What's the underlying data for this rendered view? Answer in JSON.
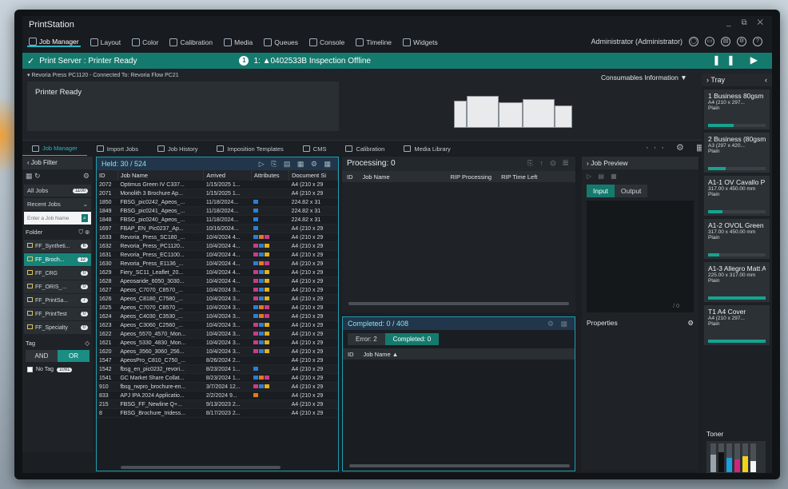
{
  "app": {
    "title": "PrintStation",
    "window_controls": "_ ⧉ ✕"
  },
  "menu": [
    {
      "label": "Job Manager",
      "active": true
    },
    {
      "label": "Layout"
    },
    {
      "label": "Color"
    },
    {
      "label": "Calibration"
    },
    {
      "label": "Media"
    },
    {
      "label": "Queues"
    },
    {
      "label": "Console"
    },
    {
      "label": "Timeline"
    },
    {
      "label": "Widgets"
    }
  ],
  "user": "Administrator (Administrator)",
  "status": {
    "server": "Print Server : Printer Ready",
    "count": "1",
    "alert": "1: ▲0402533B  Inspection Offline",
    "controls": "❚❚ ▶"
  },
  "printer": {
    "connection": "Revoria Press PC1120 - Connected To: Revoria Flow PC21",
    "state": "Printer Ready",
    "consumables": "Consumables Information ▼"
  },
  "tabs": [
    {
      "label": "Job Manager",
      "active": true
    },
    {
      "label": "Import Jobs"
    },
    {
      "label": "Job History"
    },
    {
      "label": "Imposition Templates"
    },
    {
      "label": "CMS"
    },
    {
      "label": "Calibration"
    },
    {
      "label": "Media Library"
    }
  ],
  "tabs_right": "··· ⚙ ▦",
  "left": {
    "filter_label": "Job Filter",
    "all_jobs": "All Jobs",
    "all_count": "1100",
    "recent": "Recent Jobs",
    "search_placeholder": "Enter a Job Name",
    "folder_label": "Folder",
    "folders": [
      {
        "name": "FF_Syntheti...",
        "count": "6"
      },
      {
        "name": "FF_Broch...",
        "count": "12",
        "sel": true
      },
      {
        "name": "FF_CRG",
        "count": "0"
      },
      {
        "name": "FF_ORIS_...",
        "count": "0"
      },
      {
        "name": "FF_PrintSa...",
        "count": "7"
      },
      {
        "name": "FF_PrintTest",
        "count": "0"
      },
      {
        "name": "FF_Specialty",
        "count": "0"
      }
    ],
    "tag_label": "Tag",
    "and": "AND",
    "or": "OR",
    "notag": "No Tag",
    "notag_count": "1091"
  },
  "held": {
    "title": "Held: 30 / 524",
    "tools": "▷ ⎘ ▤ ▦ ⚙ ▦",
    "columns": [
      "ID",
      "Job Name",
      "Arrived",
      "Attributes",
      "Document Si"
    ],
    "rows": [
      [
        "2072",
        "Optimus Green IV C337...",
        "1/15/2025 1...",
        "",
        "A4 (210 x 29"
      ],
      [
        "2071",
        "Monolith 3 Brochure Ap...",
        "1/15/2025 1...",
        "",
        "A4 (210 x 29"
      ],
      [
        "1850",
        "FBSG_pic0242_Apeos_...",
        "11/18/2024...",
        "b",
        "224.82 x 31"
      ],
      [
        "1849",
        "FBSG_pic0241_Apeos_...",
        "11/18/2024...",
        "b",
        "224.82 x 31"
      ],
      [
        "1848",
        "FBSG_pic0240_Apeos_...",
        "11/18/2024...",
        "b",
        "224.82 x 31"
      ],
      [
        "1697",
        "FBAP_EN_Pic0237_Ap...",
        "10/16/2024...",
        "b",
        "A4 (210 x 29"
      ],
      [
        "1633",
        "Revoria_Press_SC180_...",
        "10/4/2024 4...",
        "m",
        "A4 (210 x 29"
      ],
      [
        "1632",
        "Revoria_Press_PC1120...",
        "10/4/2024 4...",
        "d",
        "A4 (210 x 29"
      ],
      [
        "1631",
        "Revoria_Press_EC1100...",
        "10/4/2024 4...",
        "d",
        "A4 (210 x 29"
      ],
      [
        "1630",
        "Revoria_Press_E1136_...",
        "10/4/2024 4...",
        "m",
        "A4 (210 x 29"
      ],
      [
        "1629",
        "Fiery_SC11_Leaflet_20...",
        "10/4/2024 4...",
        "d",
        "A4 (210 x 29"
      ],
      [
        "1628",
        "Apeosaride_6050_3030...",
        "10/4/2024 4...",
        "d",
        "A4 (210 x 29"
      ],
      [
        "1627",
        "Apeos_C7070_C8570_...",
        "10/4/2024 3...",
        "d",
        "A4 (210 x 29"
      ],
      [
        "1626",
        "Apeos_C8180_C7580_...",
        "10/4/2024 3...",
        "d",
        "A4 (210 x 29"
      ],
      [
        "1625",
        "Apeos_C7070_C8570_...",
        "10/4/2024 3...",
        "m",
        "A4 (210 x 29"
      ],
      [
        "1624",
        "Apeos_C4030_C3530_...",
        "10/4/2024 3...",
        "m",
        "A4 (210 x 29"
      ],
      [
        "1623",
        "Apeos_C3060_C2560_...",
        "10/4/2024 3...",
        "d",
        "A4 (210 x 29"
      ],
      [
        "1622",
        "Apeos_5570_4570_Mon...",
        "10/4/2024 3...",
        "d",
        "A4 (210 x 29"
      ],
      [
        "1621",
        "Apeos_5330_4830_Mon...",
        "10/4/2024 3...",
        "d",
        "A4 (210 x 29"
      ],
      [
        "1620",
        "Apeos_3560_3060_256...",
        "10/4/2024 3...",
        "d",
        "A4 (210 x 29"
      ],
      [
        "1547",
        "ApeosPro_C810_C750_...",
        "8/26/2024 2...",
        "",
        "A4 (210 x 29"
      ],
      [
        "1542",
        "fbsg_en_pic0232_revori...",
        "8/23/2024 1...",
        "b",
        "A4 (210 x 29"
      ],
      [
        "1541",
        "GC Market Share Collat...",
        "8/23/2024 1...",
        "m",
        "A4 (210 x 29"
      ],
      [
        "910",
        "fbsg_rwpro_brochure-en...",
        "3/7/2024 12...",
        "d",
        "A4 (210 x 29"
      ],
      [
        "833",
        "APJ IPA 2024 Applicatio...",
        "2/2/2024 9...",
        "p",
        "A4 (210 x 29"
      ],
      [
        "215",
        "FBSG_FF_Newline Q+...",
        "9/13/2023 2...",
        "",
        "A4 (210 x 29"
      ],
      [
        "8",
        "FBSG_Brochure_Iridess...",
        "8/17/2023 2...",
        "",
        "A4 (210 x 29"
      ]
    ]
  },
  "processing": {
    "title": "Processing: 0",
    "tools": "⎘ ↑ ⚙ ▦",
    "columns": [
      "ID",
      "Job Name",
      "RIP Processing",
      "RIP Time Left"
    ]
  },
  "completed": {
    "title": "Completed: 0 / 408",
    "tools": "⚙ ▦",
    "error_tab": "Error: 2",
    "completed_tab": "Completed: 0",
    "columns": [
      "ID",
      "Job Name ▲"
    ]
  },
  "preview": {
    "title": "Job Preview",
    "tools": "▷ ▤ ▦",
    "input": "Input",
    "output": "Output",
    "page": "/ 0",
    "properties": "Properties"
  },
  "tray": {
    "title": "Tray",
    "items": [
      {
        "name": "1 Business 80gsm",
        "size": "A4 (210 x 297...",
        "type": "Plain",
        "level": 0.45
      },
      {
        "name": "2 Business (80gsm",
        "size": "A3 (297 x 420...",
        "type": "Plain",
        "level": 0.3
      },
      {
        "name": "A1-1 OV Cavallo P",
        "size": "317.00 x 450.00 mm",
        "type": "Plain",
        "level": 0.25
      },
      {
        "name": "A1-2 OVOL Green",
        "size": "317.00 x 450.00 mm",
        "type": "Plain",
        "level": 0.2
      },
      {
        "name": "A1-3 Allegro Matt A",
        "size": "225.00 x 317.00 mm",
        "type": "Plain",
        "level": 1.0
      },
      {
        "name": "T1 A4 Cover",
        "size": "A4 (210 x 297...",
        "type": "Plain",
        "level": 1.0
      }
    ],
    "toner_label": "Toner",
    "toner": [
      {
        "label": "SLV",
        "color": "#9aa3ab",
        "level": 0.6
      },
      {
        "label": "K",
        "color": "#111111",
        "level": 0.7
      },
      {
        "label": "C",
        "color": "#1aa0e0",
        "level": 0.5
      },
      {
        "label": "M",
        "color": "#d0247a",
        "level": 0.45
      },
      {
        "label": "Y",
        "color": "#f2d21a",
        "level": 0.55
      },
      {
        "label": "W",
        "color": "#f4f4f4",
        "level": 0.4
      }
    ]
  }
}
